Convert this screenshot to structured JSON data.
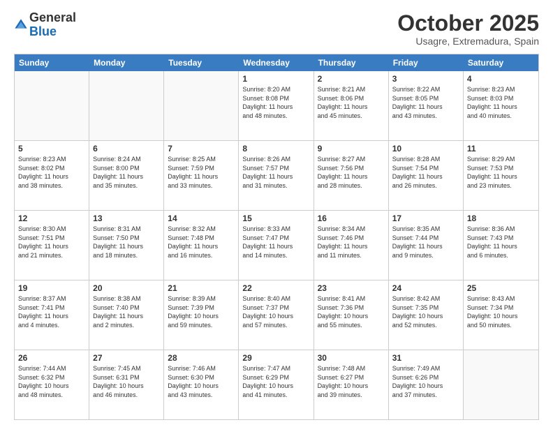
{
  "header": {
    "logo_general": "General",
    "logo_blue": "Blue",
    "month_title": "October 2025",
    "location": "Usagre, Extremadura, Spain"
  },
  "days_of_week": [
    "Sunday",
    "Monday",
    "Tuesday",
    "Wednesday",
    "Thursday",
    "Friday",
    "Saturday"
  ],
  "rows": [
    [
      {
        "day": "",
        "lines": []
      },
      {
        "day": "",
        "lines": []
      },
      {
        "day": "",
        "lines": []
      },
      {
        "day": "1",
        "lines": [
          "Sunrise: 8:20 AM",
          "Sunset: 8:08 PM",
          "Daylight: 11 hours",
          "and 48 minutes."
        ]
      },
      {
        "day": "2",
        "lines": [
          "Sunrise: 8:21 AM",
          "Sunset: 8:06 PM",
          "Daylight: 11 hours",
          "and 45 minutes."
        ]
      },
      {
        "day": "3",
        "lines": [
          "Sunrise: 8:22 AM",
          "Sunset: 8:05 PM",
          "Daylight: 11 hours",
          "and 43 minutes."
        ]
      },
      {
        "day": "4",
        "lines": [
          "Sunrise: 8:23 AM",
          "Sunset: 8:03 PM",
          "Daylight: 11 hours",
          "and 40 minutes."
        ]
      }
    ],
    [
      {
        "day": "5",
        "lines": [
          "Sunrise: 8:23 AM",
          "Sunset: 8:02 PM",
          "Daylight: 11 hours",
          "and 38 minutes."
        ]
      },
      {
        "day": "6",
        "lines": [
          "Sunrise: 8:24 AM",
          "Sunset: 8:00 PM",
          "Daylight: 11 hours",
          "and 35 minutes."
        ]
      },
      {
        "day": "7",
        "lines": [
          "Sunrise: 8:25 AM",
          "Sunset: 7:59 PM",
          "Daylight: 11 hours",
          "and 33 minutes."
        ]
      },
      {
        "day": "8",
        "lines": [
          "Sunrise: 8:26 AM",
          "Sunset: 7:57 PM",
          "Daylight: 11 hours",
          "and 31 minutes."
        ]
      },
      {
        "day": "9",
        "lines": [
          "Sunrise: 8:27 AM",
          "Sunset: 7:56 PM",
          "Daylight: 11 hours",
          "and 28 minutes."
        ]
      },
      {
        "day": "10",
        "lines": [
          "Sunrise: 8:28 AM",
          "Sunset: 7:54 PM",
          "Daylight: 11 hours",
          "and 26 minutes."
        ]
      },
      {
        "day": "11",
        "lines": [
          "Sunrise: 8:29 AM",
          "Sunset: 7:53 PM",
          "Daylight: 11 hours",
          "and 23 minutes."
        ]
      }
    ],
    [
      {
        "day": "12",
        "lines": [
          "Sunrise: 8:30 AM",
          "Sunset: 7:51 PM",
          "Daylight: 11 hours",
          "and 21 minutes."
        ]
      },
      {
        "day": "13",
        "lines": [
          "Sunrise: 8:31 AM",
          "Sunset: 7:50 PM",
          "Daylight: 11 hours",
          "and 18 minutes."
        ]
      },
      {
        "day": "14",
        "lines": [
          "Sunrise: 8:32 AM",
          "Sunset: 7:48 PM",
          "Daylight: 11 hours",
          "and 16 minutes."
        ]
      },
      {
        "day": "15",
        "lines": [
          "Sunrise: 8:33 AM",
          "Sunset: 7:47 PM",
          "Daylight: 11 hours",
          "and 14 minutes."
        ]
      },
      {
        "day": "16",
        "lines": [
          "Sunrise: 8:34 AM",
          "Sunset: 7:46 PM",
          "Daylight: 11 hours",
          "and 11 minutes."
        ]
      },
      {
        "day": "17",
        "lines": [
          "Sunrise: 8:35 AM",
          "Sunset: 7:44 PM",
          "Daylight: 11 hours",
          "and 9 minutes."
        ]
      },
      {
        "day": "18",
        "lines": [
          "Sunrise: 8:36 AM",
          "Sunset: 7:43 PM",
          "Daylight: 11 hours",
          "and 6 minutes."
        ]
      }
    ],
    [
      {
        "day": "19",
        "lines": [
          "Sunrise: 8:37 AM",
          "Sunset: 7:41 PM",
          "Daylight: 11 hours",
          "and 4 minutes."
        ]
      },
      {
        "day": "20",
        "lines": [
          "Sunrise: 8:38 AM",
          "Sunset: 7:40 PM",
          "Daylight: 11 hours",
          "and 2 minutes."
        ]
      },
      {
        "day": "21",
        "lines": [
          "Sunrise: 8:39 AM",
          "Sunset: 7:39 PM",
          "Daylight: 10 hours",
          "and 59 minutes."
        ]
      },
      {
        "day": "22",
        "lines": [
          "Sunrise: 8:40 AM",
          "Sunset: 7:37 PM",
          "Daylight: 10 hours",
          "and 57 minutes."
        ]
      },
      {
        "day": "23",
        "lines": [
          "Sunrise: 8:41 AM",
          "Sunset: 7:36 PM",
          "Daylight: 10 hours",
          "and 55 minutes."
        ]
      },
      {
        "day": "24",
        "lines": [
          "Sunrise: 8:42 AM",
          "Sunset: 7:35 PM",
          "Daylight: 10 hours",
          "and 52 minutes."
        ]
      },
      {
        "day": "25",
        "lines": [
          "Sunrise: 8:43 AM",
          "Sunset: 7:34 PM",
          "Daylight: 10 hours",
          "and 50 minutes."
        ]
      }
    ],
    [
      {
        "day": "26",
        "lines": [
          "Sunrise: 7:44 AM",
          "Sunset: 6:32 PM",
          "Daylight: 10 hours",
          "and 48 minutes."
        ]
      },
      {
        "day": "27",
        "lines": [
          "Sunrise: 7:45 AM",
          "Sunset: 6:31 PM",
          "Daylight: 10 hours",
          "and 46 minutes."
        ]
      },
      {
        "day": "28",
        "lines": [
          "Sunrise: 7:46 AM",
          "Sunset: 6:30 PM",
          "Daylight: 10 hours",
          "and 43 minutes."
        ]
      },
      {
        "day": "29",
        "lines": [
          "Sunrise: 7:47 AM",
          "Sunset: 6:29 PM",
          "Daylight: 10 hours",
          "and 41 minutes."
        ]
      },
      {
        "day": "30",
        "lines": [
          "Sunrise: 7:48 AM",
          "Sunset: 6:27 PM",
          "Daylight: 10 hours",
          "and 39 minutes."
        ]
      },
      {
        "day": "31",
        "lines": [
          "Sunrise: 7:49 AM",
          "Sunset: 6:26 PM",
          "Daylight: 10 hours",
          "and 37 minutes."
        ]
      },
      {
        "day": "",
        "lines": []
      }
    ]
  ]
}
